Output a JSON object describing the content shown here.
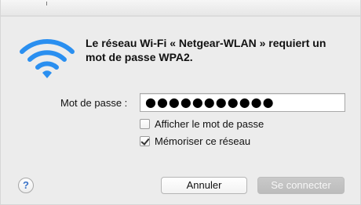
{
  "dialog": {
    "message": "Le réseau Wi-Fi « Netgear-WLAN » requiert un mot de passe WPA2.",
    "icon": "wifi-icon",
    "accent_color": "#2a8ff0"
  },
  "password": {
    "label": "Mot de passe :",
    "value": "●●●●●●●●●●●"
  },
  "options": {
    "show_password": {
      "label": "Afficher le mot de passe",
      "checked": false
    },
    "remember_network": {
      "label": "Mémoriser ce réseau",
      "checked": true
    }
  },
  "buttons": {
    "help": "?",
    "cancel": "Annuler",
    "connect": "Se connecter",
    "connect_enabled": false
  }
}
